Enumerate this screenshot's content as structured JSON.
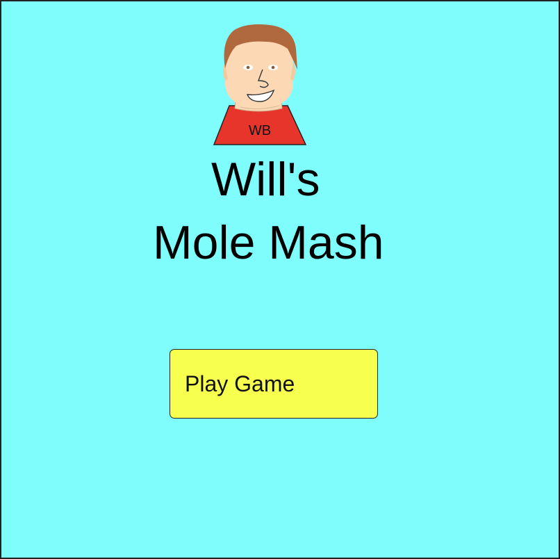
{
  "colors": {
    "background": "#7ffdfd",
    "button_fill": "#f7ff4f",
    "shirt": "#e8352c",
    "hair": "#b0683e",
    "skin": "#fcd9b4"
  },
  "avatar": {
    "icon": "player-face-icon",
    "shirt_text": "WB"
  },
  "title": {
    "line1": "Will's",
    "line2": "Mole Mash"
  },
  "play_button": {
    "label": "Play Game"
  }
}
